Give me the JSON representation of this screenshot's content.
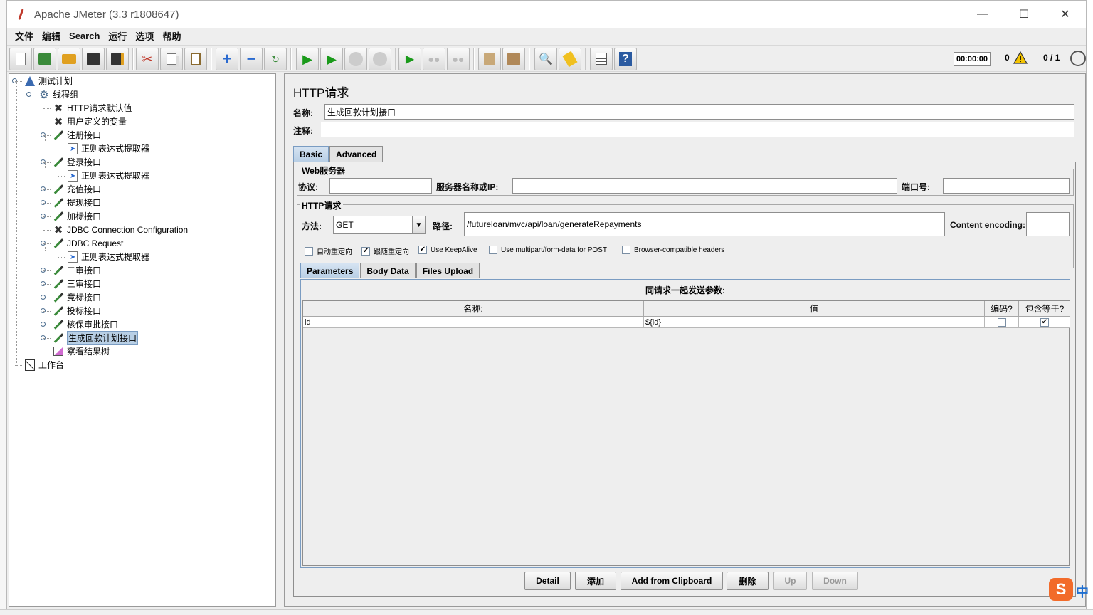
{
  "window": {
    "title": "Apache JMeter (3.3 r1808647)"
  },
  "menu": [
    "文件",
    "编辑",
    "Search",
    "运行",
    "选项",
    "帮助"
  ],
  "toolbar_icons": [
    "new-icon",
    "templates-icon",
    "open-icon",
    "save-icon",
    "save-as-icon",
    "cut-icon",
    "copy-icon",
    "paste-icon",
    "expand-icon",
    "collapse-icon",
    "toggle-icon",
    "start-icon",
    "start-no-pause-icon",
    "stop-icon",
    "shutdown-icon",
    "remote-start-icon",
    "remote-stop-icon",
    "remote-shutdown-icon",
    "clear-icon",
    "clear-all-icon",
    "search-icon",
    "reset-search-icon",
    "function-helper-icon",
    "help-icon"
  ],
  "status": {
    "timer": "00:00:00",
    "errors": "0",
    "threads": "0 / 1"
  },
  "tree": [
    {
      "label": "测试计划",
      "icon": "flask-icon"
    },
    {
      "label": "线程组",
      "icon": "gear-icon"
    },
    {
      "label": "HTTP请求默认值",
      "icon": "tools-icon"
    },
    {
      "label": "用户定义的变量",
      "icon": "tools-icon"
    },
    {
      "label": "注册接口",
      "icon": "pipette-icon"
    },
    {
      "label": "正则表达式提取器",
      "icon": "extractor-icon"
    },
    {
      "label": "登录接口",
      "icon": "pipette-icon"
    },
    {
      "label": "正则表达式提取器",
      "icon": "extractor-icon"
    },
    {
      "label": "充值接口",
      "icon": "pipette-icon"
    },
    {
      "label": "提现接口",
      "icon": "pipette-icon"
    },
    {
      "label": "加标接口",
      "icon": "pipette-icon"
    },
    {
      "label": "JDBC Connection Configuration",
      "icon": "tools-icon"
    },
    {
      "label": "JDBC Request",
      "icon": "pipette-icon"
    },
    {
      "label": "正则表达式提取器",
      "icon": "extractor-icon"
    },
    {
      "label": "二审接口",
      "icon": "pipette-icon"
    },
    {
      "label": "三审接口",
      "icon": "pipette-icon"
    },
    {
      "label": "竞标接口",
      "icon": "pipette-icon"
    },
    {
      "label": "投标接口",
      "icon": "pipette-icon"
    },
    {
      "label": "核保审批接口",
      "icon": "pipette-icon"
    },
    {
      "label": "生成回款计划接口",
      "icon": "pipette-icon"
    },
    {
      "label": "察看结果树",
      "icon": "chart-icon"
    },
    {
      "label": "工作台",
      "icon": "workbench-icon"
    }
  ],
  "form": {
    "title": "HTTP请求",
    "name_label": "名称:",
    "name_value": "生成回款计划接口",
    "comment_label": "注释:",
    "comment_value": "",
    "tabs": [
      "Basic",
      "Advanced"
    ],
    "web_server": {
      "legend": "Web服务器",
      "protocol_label": "协议:",
      "protocol_value": "",
      "server_label": "服务器名称或IP:",
      "server_value": "",
      "port_label": "端口号:",
      "port_value": ""
    },
    "http_request": {
      "legend": "HTTP请求",
      "method_label": "方法:",
      "method_value": "GET",
      "path_label": "路径:",
      "path_value": "/futureloan/mvc/api/loan/generateRepayments",
      "encoding_label": "Content encoding:",
      "encoding_value": ""
    },
    "checkboxes": [
      {
        "label": "自动重定向",
        "checked": false
      },
      {
        "label": "跟随重定向",
        "checked": true
      },
      {
        "label": "Use KeepAlive",
        "checked": true
      },
      {
        "label": "Use multipart/form-data for POST",
        "checked": false
      },
      {
        "label": "Browser-compatible headers",
        "checked": false
      }
    ],
    "sub_tabs": [
      "Parameters",
      "Body Data",
      "Files Upload"
    ],
    "params": {
      "caption": "同请求一起发送参数:",
      "columns": [
        "名称:",
        "值",
        "编码?",
        "包含等于?"
      ],
      "rows": [
        {
          "name": "id",
          "value": "${id}",
          "encode": false,
          "include_equals": true
        }
      ]
    },
    "buttons": [
      {
        "label": "Detail",
        "enabled": true
      },
      {
        "label": "添加",
        "enabled": true
      },
      {
        "label": "Add from Clipboard",
        "enabled": true
      },
      {
        "label": "删除",
        "enabled": true
      },
      {
        "label": "Up",
        "enabled": false
      },
      {
        "label": "Down",
        "enabled": false
      }
    ]
  },
  "ime": {
    "logo": "S",
    "mode": "中"
  }
}
